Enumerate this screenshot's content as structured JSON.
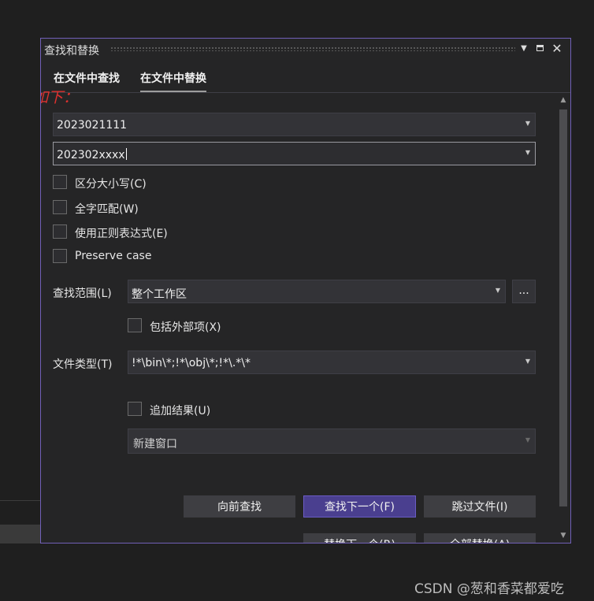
{
  "dialog": {
    "title": "查找和替换",
    "tabs": [
      {
        "label": "在文件中查找",
        "active": false
      },
      {
        "label": "在文件中替换",
        "active": true
      }
    ]
  },
  "annotation": "如下：",
  "find_field": {
    "value": "2023021111"
  },
  "replace_field": {
    "value": "202302xxxx"
  },
  "options": [
    {
      "label": "区分大小写(C)",
      "checked": false
    },
    {
      "label": "全字匹配(W)",
      "checked": false
    },
    {
      "label": "使用正则表达式(E)",
      "checked": false
    },
    {
      "label": "Preserve case",
      "checked": false
    }
  ],
  "scope": {
    "label": "查找范围(L)",
    "value": "整个工作区",
    "browse_label": "...",
    "include_external": {
      "label": "包括外部项(X)",
      "checked": false
    }
  },
  "file_types": {
    "label": "文件类型(T)",
    "value": "!*\\bin\\*;!*\\obj\\*;!*\\.*\\*"
  },
  "append_results": {
    "label": "追加结果(U)",
    "checked": false
  },
  "result_window": {
    "value": "新建窗口"
  },
  "buttons": {
    "find_previous": "向前查找",
    "find_next": "查找下一个(F)",
    "skip_file": "跳过文件(I)",
    "replace_next": "替换下一个(R)",
    "replace_all": "全部替换(A)"
  },
  "colors": {
    "accent": "#7160b8",
    "primary_button": "#4a3f8f",
    "annotation": "#e0312f"
  },
  "watermark": "CSDN @葱和香菜都爱吃"
}
